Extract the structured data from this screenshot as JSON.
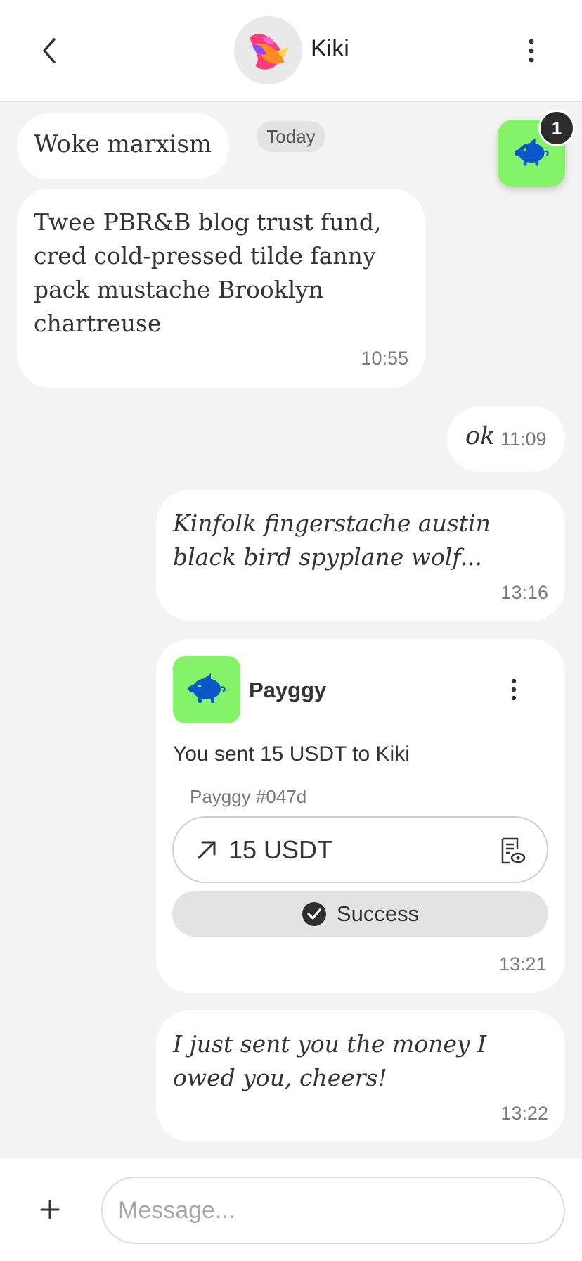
{
  "header": {
    "contact_name": "Kiki",
    "back_icon": "chevron-left-icon",
    "more_icon": "vertical-ellipsis-icon"
  },
  "chat": {
    "date_separator": "Today",
    "fab_badge_count": "1",
    "messages": [
      {
        "direction": "incoming",
        "text": "Woke marxism",
        "time": ""
      },
      {
        "direction": "incoming",
        "text": "Twee PBR&B blog trust fund, cred cold-pressed tilde fanny pack mustache Brooklyn chartreuse",
        "time": "10:55"
      },
      {
        "direction": "outgoing",
        "text": "ok",
        "time": "11:09"
      },
      {
        "direction": "outgoing",
        "text": "Kinfolk fingerstache austin black bird spyplane wolf...",
        "time": "13:16"
      },
      {
        "direction": "outgoing",
        "text": "I just sent you the money I owed you, cheers!",
        "time": "13:22"
      }
    ],
    "payment_card": {
      "app_name": "Payggy",
      "description": "You sent 15 USDT to Kiki",
      "reference": "Payggy #047d",
      "amount": "15 USDT",
      "status": "Success",
      "time": "13:21"
    }
  },
  "composer": {
    "placeholder": "Message..."
  },
  "colors": {
    "background": "#f3f3f3",
    "bubble": "#ffffff",
    "payggy_green": "#84f36a",
    "piggy_blue": "#0a57c9"
  }
}
